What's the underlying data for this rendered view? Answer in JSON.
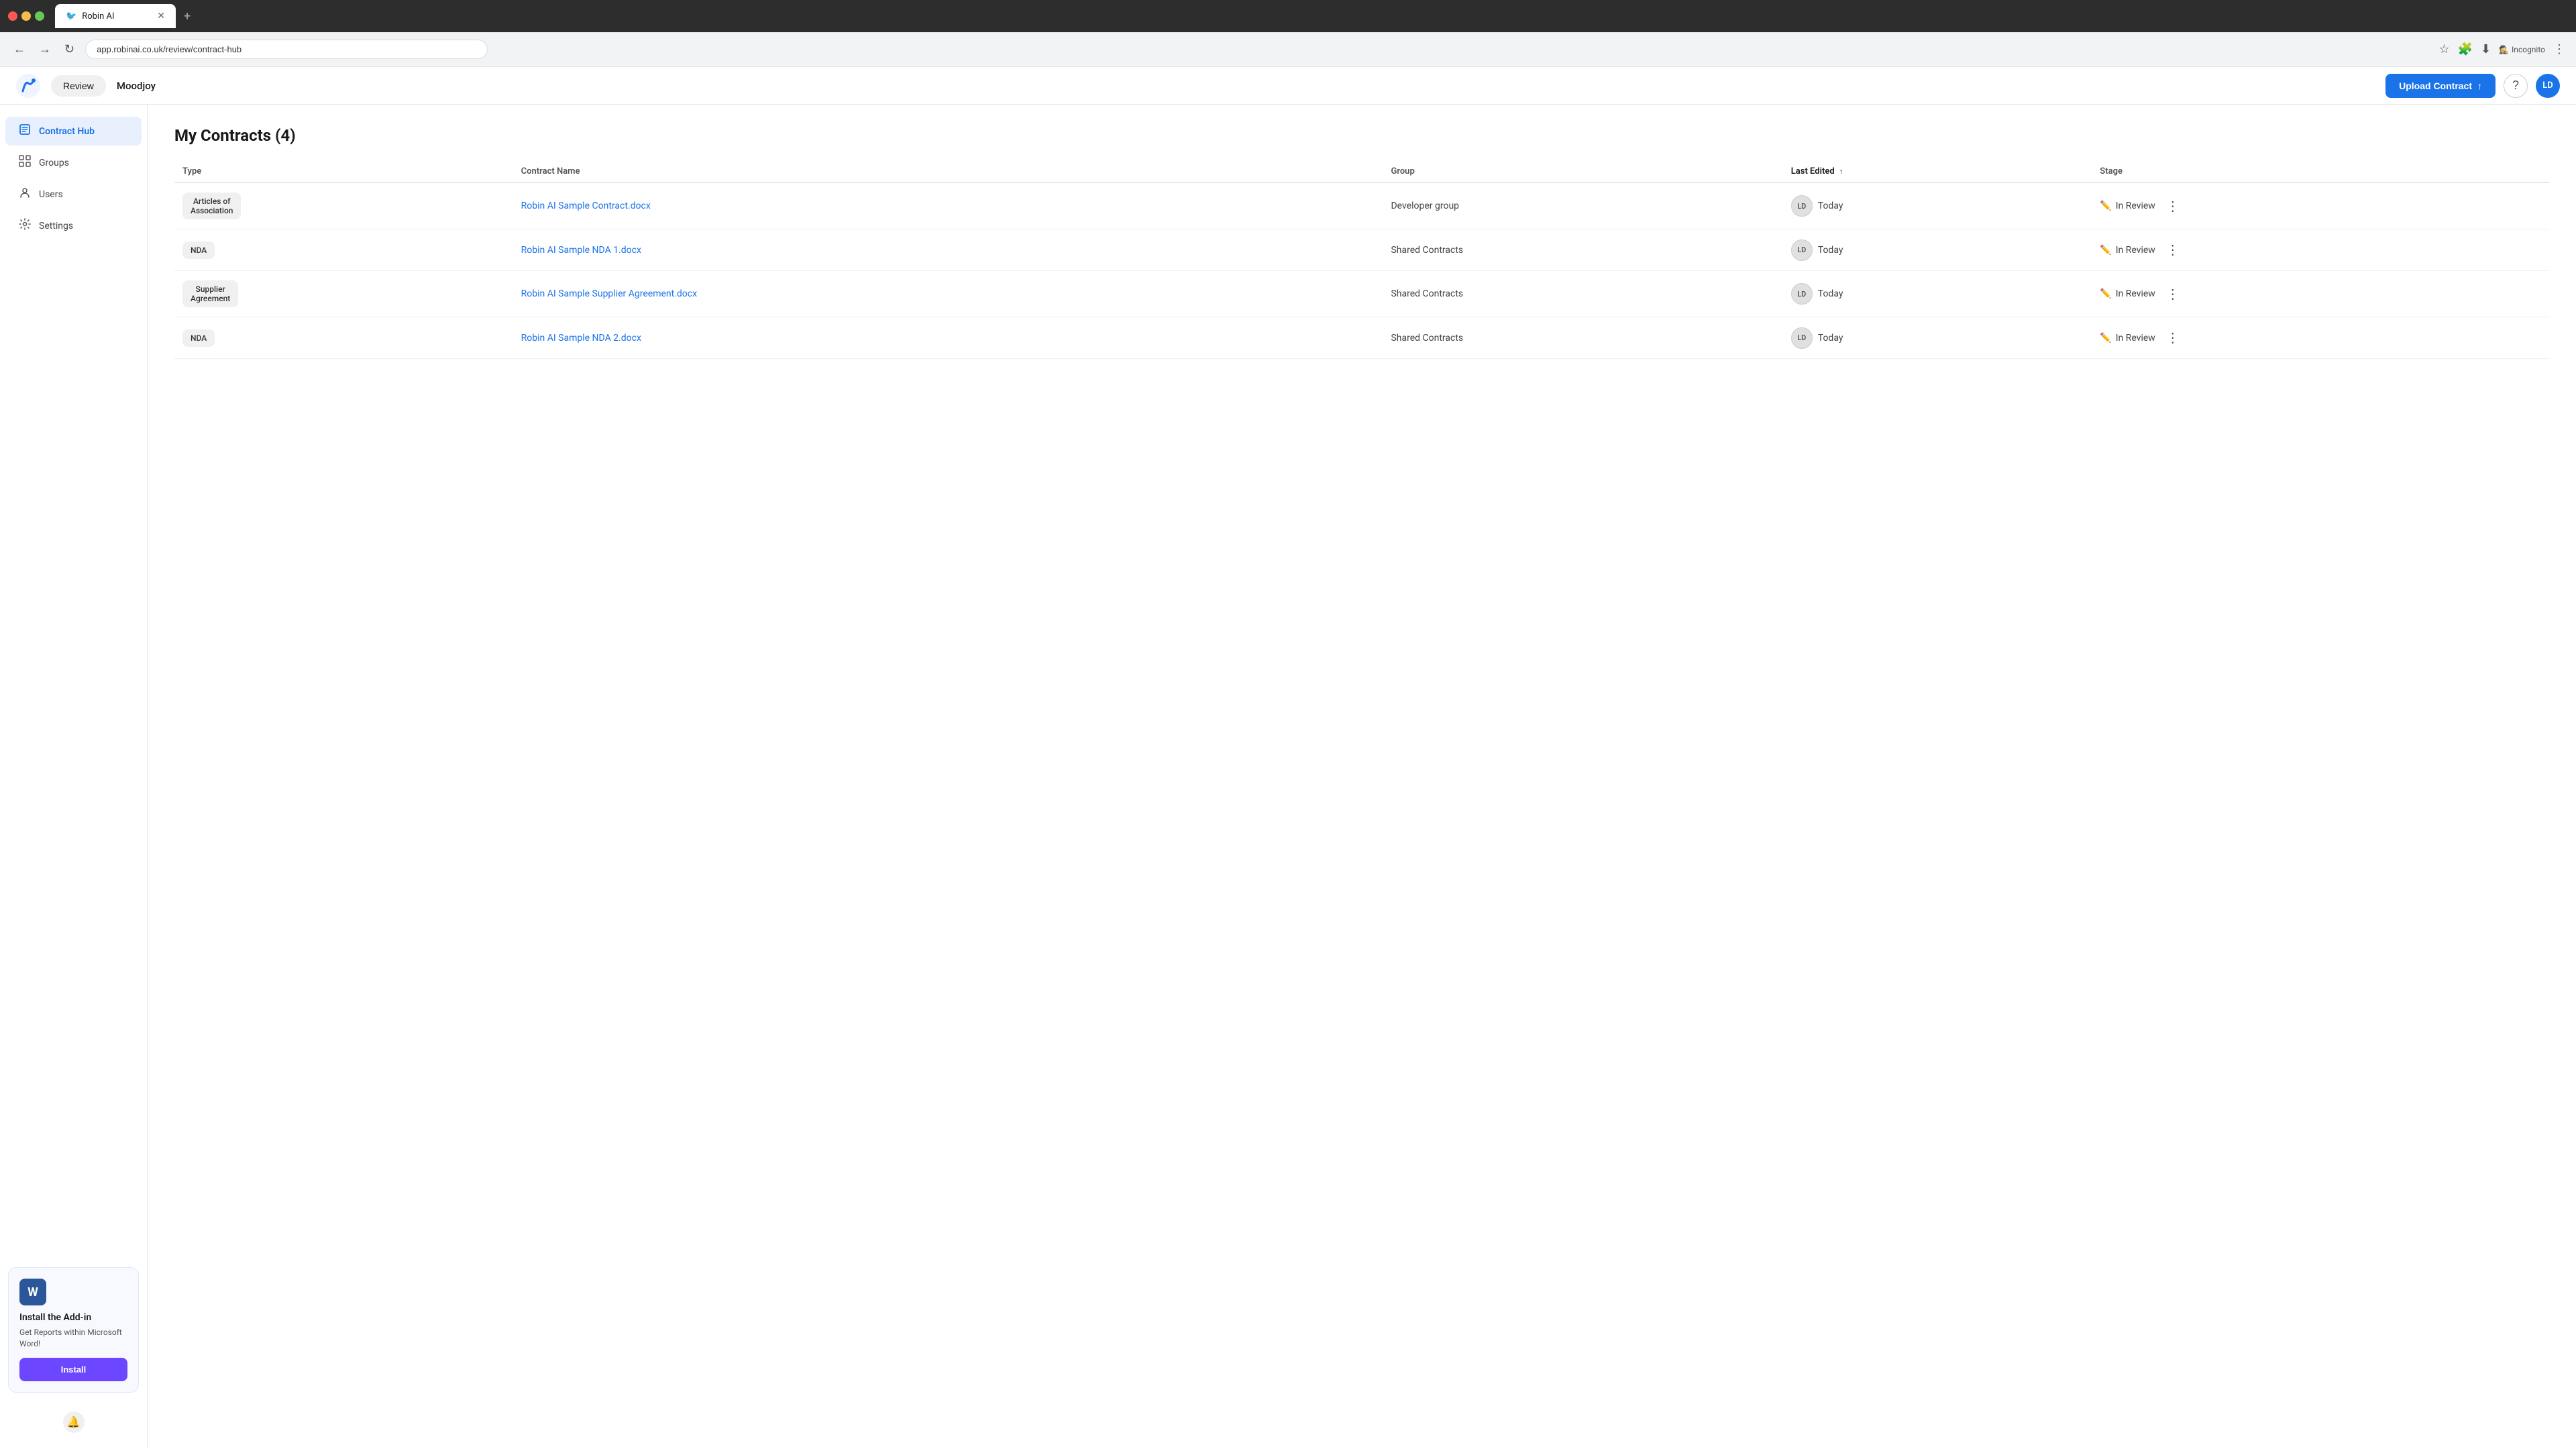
{
  "browser": {
    "tab_title": "Robin AI",
    "url": "app.robinai.co.uk/review/contract-hub",
    "incognito_label": "Incognito"
  },
  "header": {
    "review_label": "Review",
    "company_name": "Moodjoy",
    "upload_label": "Upload Contract",
    "avatar_initials": "LD"
  },
  "sidebar": {
    "items": [
      {
        "label": "Contract Hub",
        "icon": "🏠",
        "active": true
      },
      {
        "label": "Groups",
        "icon": "⊞"
      },
      {
        "label": "Users",
        "icon": "👤"
      },
      {
        "label": "Settings",
        "icon": "⚙️"
      }
    ],
    "addin": {
      "title": "Install the Add-in",
      "description": "Get Reports within Microsoft Word!",
      "button_label": "Install"
    }
  },
  "main": {
    "page_title": "My Contracts (4)",
    "table": {
      "columns": [
        "Type",
        "Contract Name",
        "Group",
        "Last Edited",
        "Stage"
      ],
      "rows": [
        {
          "type": "Articles of\nAssociation",
          "contract_name": "Robin AI Sample Contract.docx",
          "group": "Developer group",
          "avatar": "LD",
          "last_edited": "Today",
          "stage": "In Review"
        },
        {
          "type": "NDA",
          "contract_name": "Robin AI Sample NDA 1.docx",
          "group": "Shared Contracts",
          "avatar": "LD",
          "last_edited": "Today",
          "stage": "In Review"
        },
        {
          "type": "Supplier\nAgreement",
          "contract_name": "Robin AI Sample Supplier Agreement.docx",
          "group": "Shared Contracts",
          "avatar": "LD",
          "last_edited": "Today",
          "stage": "In Review"
        },
        {
          "type": "NDA",
          "contract_name": "Robin AI Sample NDA 2.docx",
          "group": "Shared Contracts",
          "avatar": "LD",
          "last_edited": "Today",
          "stage": "In Review"
        }
      ]
    }
  }
}
